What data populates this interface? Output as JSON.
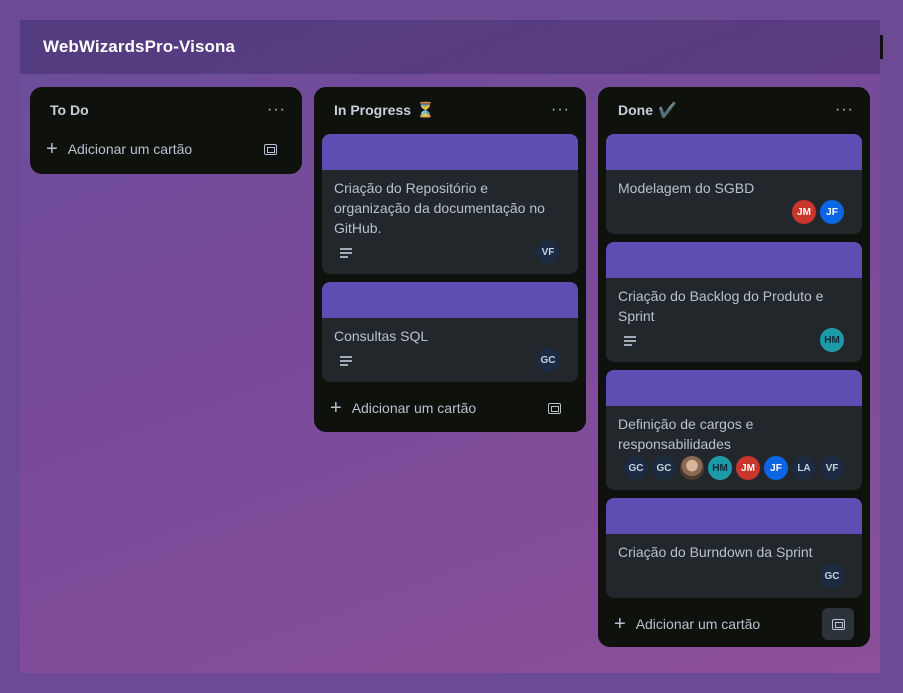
{
  "board": {
    "title": "WebWizardsPro-Visona"
  },
  "lists": [
    {
      "title": "To Do",
      "emoji": "",
      "menu": "···",
      "add_label": "Adicionar um cartão",
      "cards": []
    },
    {
      "title": "In Progress",
      "emoji": "⏳",
      "menu": "···",
      "add_label": "Adicionar um cartão",
      "cards": [
        {
          "title": "Criação do Repositório e organização da documentação no GitHub.",
          "has_description": true,
          "members": [
            "VF"
          ]
        },
        {
          "title": "Consultas SQL",
          "has_description": true,
          "members": [
            "GC"
          ]
        }
      ]
    },
    {
      "title": "Done",
      "emoji": "✔️",
      "menu": "···",
      "add_label": "Adicionar um cartão",
      "cards": [
        {
          "title": "Modelagem do SGBD",
          "has_description": false,
          "members": [
            "JM",
            "JF"
          ]
        },
        {
          "title": "Criação do Backlog do Produto e Sprint",
          "has_description": true,
          "members": [
            "HM"
          ]
        },
        {
          "title": "Definição de cargos e responsabilidades",
          "has_description": false,
          "members": [
            "GC",
            "GC",
            "photo",
            "HM",
            "JM",
            "JF",
            "LA",
            "VF"
          ]
        },
        {
          "title": "Criação do Burndown da Sprint",
          "has_description": false,
          "members": [
            "GC"
          ]
        }
      ]
    }
  ],
  "colors": {
    "card_cover": "#5e4db2",
    "list_bg": "#0f110c",
    "card_bg": "#22272b",
    "avatar_jm": "#c9372c",
    "avatar_jf": "#0c66e4",
    "avatar_hm": "#1d9aaa"
  },
  "icons": {
    "add": "plus-icon",
    "template": "card-template-icon",
    "menu": "ellipsis-icon",
    "description": "description-icon"
  }
}
